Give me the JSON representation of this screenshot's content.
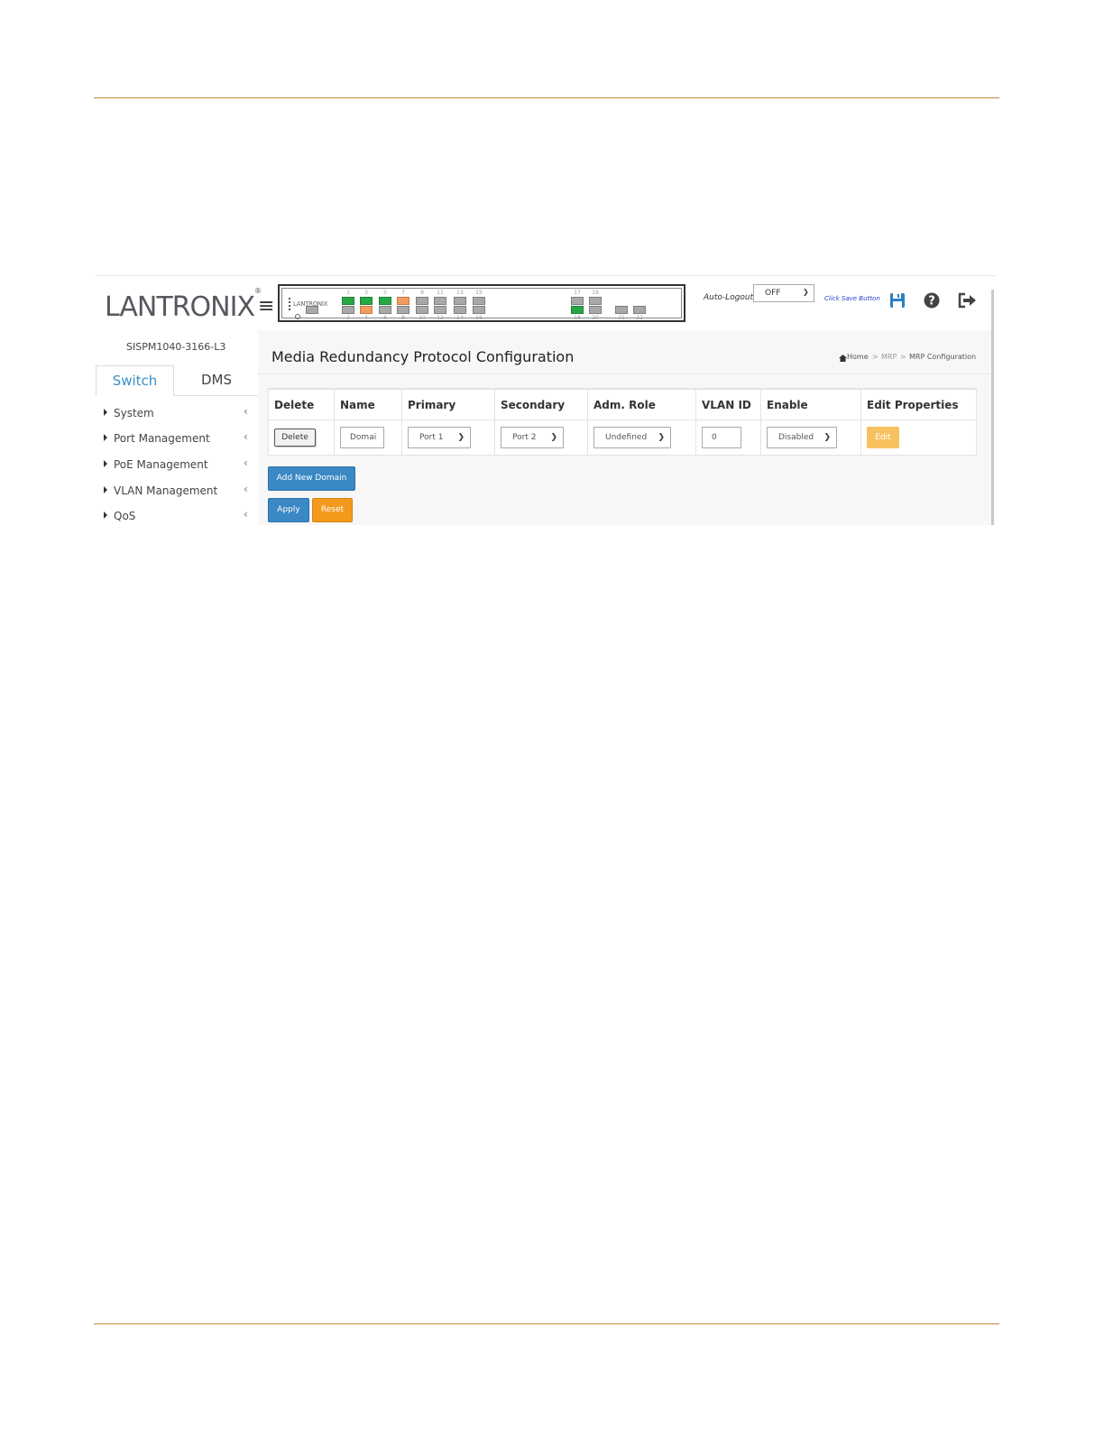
{
  "app": {
    "brand": "LANTRONIX",
    "brand_mark": "®",
    "model": "SISPM1040-3166-L3"
  },
  "header": {
    "auto_logout_label": "Auto-Logout",
    "auto_logout_value": "OFF",
    "save_hint": "Click Save Button",
    "panel_logo": "LANTRONIX",
    "ports_top": [
      "1",
      "3",
      "5",
      "7",
      "9",
      "11",
      "13",
      "15",
      "17",
      "19"
    ],
    "ports_bottom": [
      "2",
      "4",
      "6",
      "8",
      "10",
      "12",
      "14",
      "16",
      "18",
      "20",
      "21",
      "22"
    ],
    "icons": {
      "menu": "hamburger-icon",
      "save": "floppy-disk-icon",
      "help": "question-circle-icon",
      "logout": "sign-out-icon"
    },
    "port_colors": {
      "link_up": "#27a845",
      "link_warn": "#f39c62",
      "idle": "#a8a8a8"
    }
  },
  "sidebar": {
    "tabs": [
      {
        "label": "Switch"
      },
      {
        "label": "DMS"
      }
    ],
    "items": [
      {
        "label": "System"
      },
      {
        "label": "Port Management"
      },
      {
        "label": "PoE Management"
      },
      {
        "label": "VLAN Management"
      },
      {
        "label": "QoS"
      }
    ]
  },
  "page": {
    "title": "Media Redundancy Protocol Configuration",
    "breadcrumb": [
      "Home",
      ">",
      "MRP",
      ">",
      "MRP Configuration"
    ]
  },
  "table": {
    "columns": [
      "Delete",
      "Name",
      "Primary",
      "Secondary",
      "Adm. Role",
      "VLAN ID",
      "Enable",
      "Edit Properties"
    ],
    "rows": [
      {
        "delete_label": "Delete",
        "name": "Domai",
        "primary": "Port 1",
        "secondary": "Port 2",
        "role": "Undefined",
        "vlan_id": "0",
        "enable": "Disabled",
        "edit_label": "Edit"
      }
    ]
  },
  "actions": {
    "add_domain": "Add New Domain",
    "apply": "Apply",
    "reset": "Reset"
  },
  "colors": {
    "accent": "#3a88c4",
    "warn": "#f39a1c",
    "edit": "#f7c160",
    "rule": "#c8843a"
  }
}
